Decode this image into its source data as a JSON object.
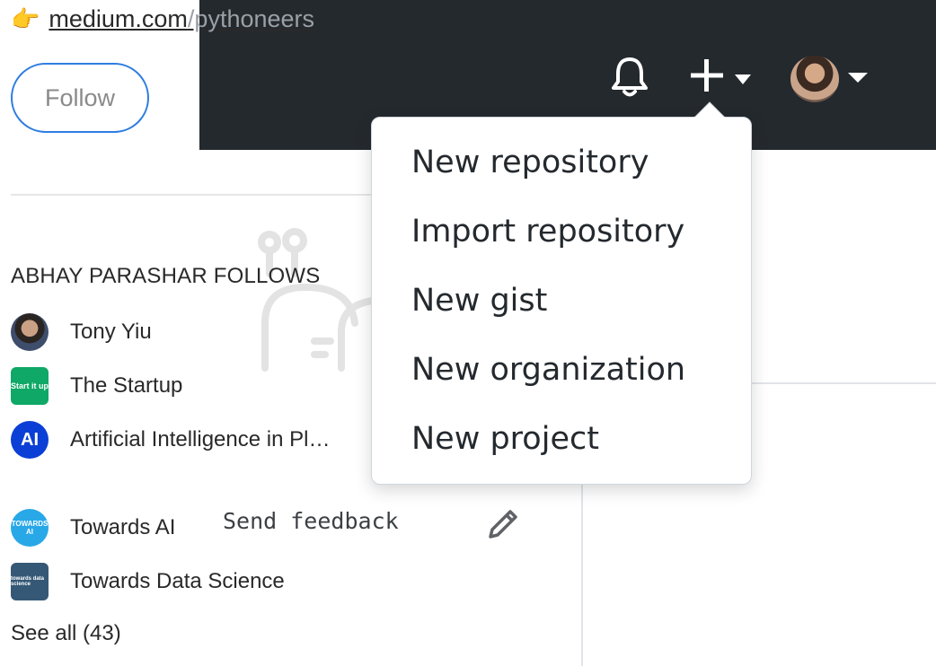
{
  "medium": {
    "link_icon": "pointing-hand-icon",
    "link_text_1": "medium.com",
    "link_text_2": "/pythoneers",
    "follow_label": "Follow",
    "follows_title": "ABHAY PARASHAR FOLLOWS",
    "follows": [
      {
        "name": "Tony Yiu",
        "icon_text": ""
      },
      {
        "name": "The Startup",
        "icon_text": "Start it up"
      },
      {
        "name": "Artificial Intelligence in Pl…",
        "icon_text": "AI"
      },
      {
        "name": "Towards AI",
        "icon_text": "TOWARDS AI"
      },
      {
        "name": "Towards Data Science",
        "icon_text": "towards data science"
      }
    ],
    "see_all": "See all (43)"
  },
  "github": {
    "header_color": "#24292e",
    "menu": {
      "items": [
        "New repository",
        "Import repository",
        "New gist",
        "New organization",
        "New project"
      ]
    }
  },
  "feedback": {
    "label": "Send feedback"
  },
  "colors": {
    "follow_border": "#2f7de1",
    "startup_green": "#0fa866",
    "ai_blue": "#0b3fd6",
    "towards_ai_blue": "#29a8e8",
    "tds_navy": "#355876"
  }
}
